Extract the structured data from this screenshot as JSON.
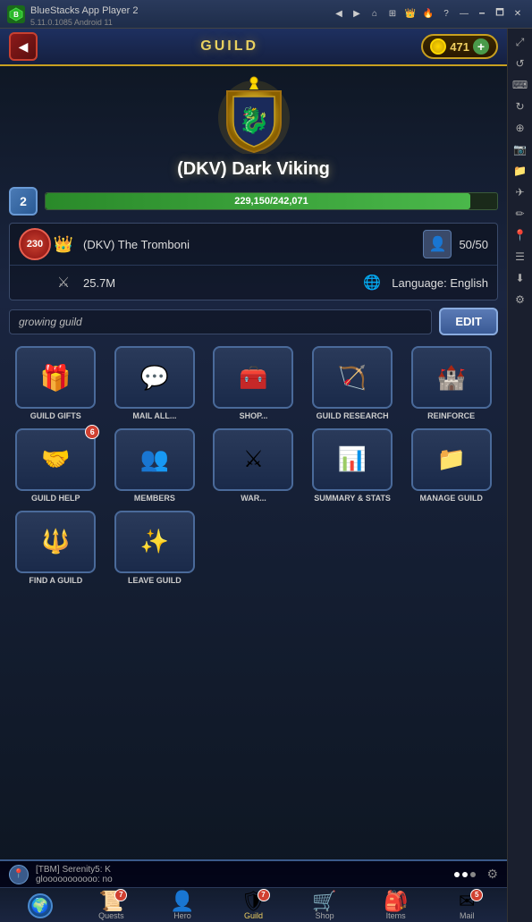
{
  "window": {
    "app_name": "BlueStacks App Player 2",
    "app_version": "5.11.0.1085  Android 11"
  },
  "header": {
    "title": "GUILD",
    "back_label": "◀",
    "currency_amount": "471",
    "plus_label": "+"
  },
  "guild": {
    "name": "(DKV) Dark Viking",
    "level": "2",
    "xp_current": "229,150",
    "xp_max": "242,071",
    "xp_label": "229,150/242,071",
    "xp_pct": 94,
    "leader": "(DKV) The Tromboni",
    "members": "50/50",
    "power": "25.7M",
    "language": "Language: English",
    "description": "growing guild",
    "rank": "230"
  },
  "actions_row1": [
    {
      "id": "guild-gifts",
      "label": "GUILD GIFTS",
      "icon": "🎁",
      "badge": ""
    },
    {
      "id": "mail-all",
      "label": "MAIL ALL...",
      "icon": "✉",
      "badge": ""
    },
    {
      "id": "shop",
      "label": "SHOP...",
      "icon": "🧰",
      "badge": ""
    },
    {
      "id": "guild-research",
      "label": "GUILD RESEARCH",
      "icon": "🏹",
      "badge": ""
    },
    {
      "id": "reinforce",
      "label": "REINFORCE",
      "icon": "⚔",
      "badge": ""
    }
  ],
  "actions_row2": [
    {
      "id": "guild-help",
      "label": "GUILD HELP",
      "icon": "🤝",
      "badge": "6"
    },
    {
      "id": "members",
      "label": "MEMBERS",
      "icon": "🧟",
      "badge": ""
    },
    {
      "id": "war",
      "label": "WAR...",
      "icon": "⚔",
      "badge": ""
    },
    {
      "id": "summary-stats",
      "label": "SUMMARY & STATS",
      "icon": "📊",
      "badge": ""
    },
    {
      "id": "manage-guild",
      "label": "MANAGE GUILD",
      "icon": "📁",
      "badge": ""
    }
  ],
  "actions_row3": [
    {
      "id": "find-guild",
      "label": "FIND A GUILD",
      "icon": "🔱",
      "badge": ""
    },
    {
      "id": "leave-guild",
      "label": "LEAVE GUILD",
      "icon": "🌟",
      "badge": ""
    }
  ],
  "notification": {
    "username": "[TBM] Serenity5: K",
    "detail": "glooooooooooo: no"
  },
  "nav_tabs": [
    {
      "id": "globe",
      "label": "🌍",
      "tab_label": "",
      "badge": ""
    },
    {
      "id": "quests",
      "label": "📜",
      "tab_label": "Quests",
      "badge": "7"
    },
    {
      "id": "hero",
      "label": "👤",
      "tab_label": "Hero",
      "badge": ""
    },
    {
      "id": "guild",
      "label": "🛡",
      "tab_label": "Guild",
      "badge": "7",
      "active": true
    },
    {
      "id": "shop",
      "label": "🛒",
      "tab_label": "Shop",
      "badge": ""
    },
    {
      "id": "items",
      "label": "🎒",
      "tab_label": "Items",
      "badge": ""
    },
    {
      "id": "mail",
      "label": "✉",
      "tab_label": "Mail",
      "badge": "5"
    }
  ],
  "right_sidebar_icons": [
    "↩",
    "↪",
    "⌨",
    "↺",
    "⊕",
    "📷",
    "📁",
    "✈",
    "🖊",
    "📍",
    "☰",
    "⬇"
  ]
}
